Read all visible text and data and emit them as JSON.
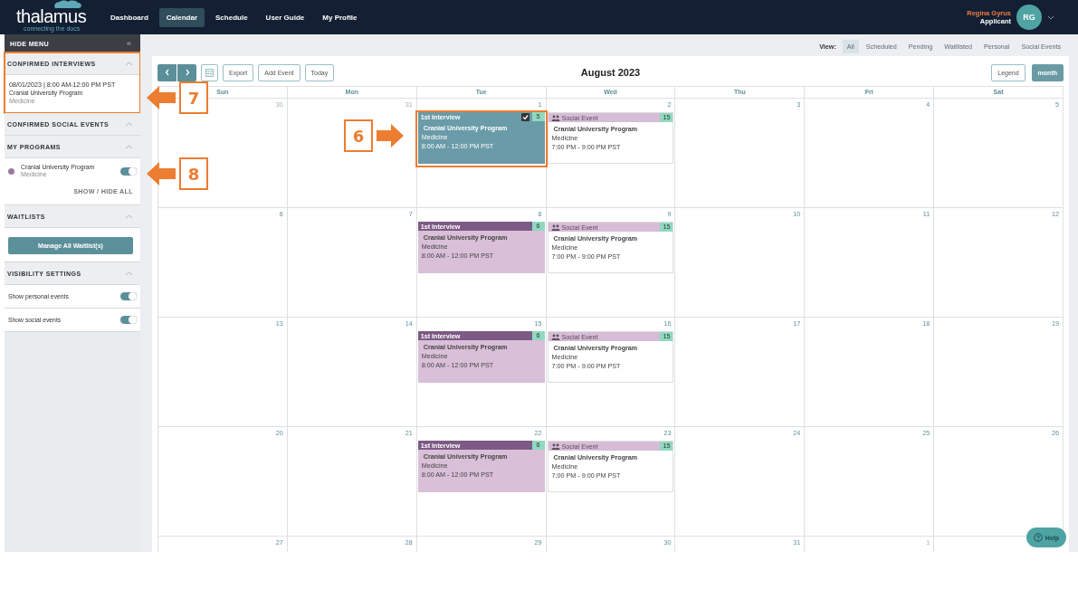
{
  "nav": {
    "logo": "thalamus",
    "tagline": "connecting the docs",
    "items": [
      {
        "label": "Dashboard",
        "selected": false
      },
      {
        "label": "Calendar",
        "selected": true
      },
      {
        "label": "Schedule",
        "selected": false
      },
      {
        "label": "User Guide",
        "selected": false
      },
      {
        "label": "My Profile",
        "selected": false
      }
    ],
    "user_name": "Regina Gyrus",
    "user_role": "Applicant",
    "avatar": "RG"
  },
  "sidebar": {
    "hide_menu": "HIDE MENU",
    "collapse_icon": "«",
    "confirmed_interviews": {
      "title": "CONFIRMED INTERVIEWS",
      "expanded": true,
      "highlighted": true,
      "items": [
        {
          "datetime": "08/01/2023 | 8:00 AM-12:00 PM PST",
          "program": "Cranial University Program",
          "specialty": "Medicine"
        }
      ]
    },
    "confirmed_social_events": {
      "title": "CONFIRMED SOCIAL EVENTS",
      "expanded": true
    },
    "my_programs": {
      "title": "MY PROGRAMS",
      "expanded": true,
      "programs": [
        {
          "name": "Cranial University Program",
          "specialty": "Medicine",
          "color": "#9e7a9c",
          "on": true
        }
      ],
      "show_hide_all": "SHOW / HIDE ALL"
    },
    "waitlists": {
      "title": "WAITLISTS",
      "expanded": true,
      "button": "Manage All Waitlist(s)"
    },
    "visibility_settings": {
      "title": "VISIBILITY SETTINGS",
      "expanded": true,
      "settings": [
        {
          "label": "Show personal events",
          "on": true
        },
        {
          "label": "Show social events",
          "on": true
        }
      ]
    }
  },
  "view_filter": {
    "label": "View:",
    "options": [
      {
        "label": "All",
        "selected": true
      },
      {
        "label": "Scheduled",
        "selected": false
      },
      {
        "label": "Pending",
        "selected": false
      },
      {
        "label": "Waitlisted",
        "selected": false
      },
      {
        "label": "Personal",
        "selected": false
      },
      {
        "label": "Social Events",
        "selected": false
      }
    ]
  },
  "calendar": {
    "buttons": [
      "Export",
      "Add Event",
      "Today"
    ],
    "title": "August 2023",
    "legend": "Legend",
    "view_button": {
      "label": "month",
      "selected": true
    },
    "weekdays": [
      "Sun",
      "Mon",
      "Tue",
      "Wed",
      "Thu",
      "Fri",
      "Sat"
    ],
    "weeks": [
      [
        {
          "day": "30",
          "outside": true
        },
        {
          "day": "31",
          "outside": true
        },
        {
          "day": "1",
          "outside": false,
          "events": [
            {
              "kind": "interview",
              "label": "1st Interview",
              "count": "5",
              "checked": true,
              "selected": true,
              "highlighted": true,
              "title": "Cranial University Program",
              "specialty": "Medicine",
              "time": "8:00 AM - 12:00 PM PST"
            }
          ]
        },
        {
          "day": "2",
          "outside": false,
          "events": [
            {
              "kind": "social",
              "label": "Social Event",
              "count": "15",
              "checked": false,
              "selected": false,
              "highlighted": false,
              "title": "Cranial University Program",
              "specialty": "Medicine",
              "time": "7:00 PM - 9:00 PM PST"
            }
          ]
        },
        {
          "day": "3",
          "outside": false
        },
        {
          "day": "4",
          "outside": false
        },
        {
          "day": "5",
          "outside": false
        }
      ],
      [
        {
          "day": "6",
          "outside": false
        },
        {
          "day": "7",
          "outside": false
        },
        {
          "day": "8",
          "outside": false,
          "events": [
            {
              "kind": "interview",
              "label": "1st Interview",
              "count": "6",
              "checked": false,
              "selected": false,
              "highlighted": false,
              "title": "Cranial University Program",
              "specialty": "Medicine",
              "time": "8:00 AM - 12:00 PM PST"
            }
          ]
        },
        {
          "day": "9",
          "outside": false,
          "events": [
            {
              "kind": "social",
              "label": "Social Event",
              "count": "15",
              "checked": false,
              "selected": false,
              "highlighted": false,
              "title": "Cranial University Program",
              "specialty": "Medicine",
              "time": "7:00 PM - 9:00 PM PST"
            }
          ]
        },
        {
          "day": "10",
          "outside": false
        },
        {
          "day": "11",
          "outside": false
        },
        {
          "day": "12",
          "outside": false
        }
      ],
      [
        {
          "day": "13",
          "outside": false
        },
        {
          "day": "14",
          "outside": false
        },
        {
          "day": "15",
          "outside": false,
          "events": [
            {
              "kind": "interview",
              "label": "1st Interview",
              "count": "6",
              "checked": false,
              "selected": false,
              "highlighted": false,
              "title": "Cranial University Program",
              "specialty": "Medicine",
              "time": "8:00 AM - 12:00 PM PST"
            }
          ]
        },
        {
          "day": "16",
          "outside": false,
          "events": [
            {
              "kind": "social",
              "label": "Social Event",
              "count": "15",
              "checked": false,
              "selected": false,
              "highlighted": false,
              "title": "Cranial University Program",
              "specialty": "Medicine",
              "time": "7:00 PM - 9:00 PM PST"
            }
          ]
        },
        {
          "day": "17",
          "outside": false
        },
        {
          "day": "18",
          "outside": false
        },
        {
          "day": "19",
          "outside": false
        }
      ],
      [
        {
          "day": "20",
          "outside": false
        },
        {
          "day": "21",
          "outside": false
        },
        {
          "day": "22",
          "outside": false,
          "events": [
            {
              "kind": "interview",
              "label": "1st Interview",
              "count": "6",
              "checked": false,
              "selected": false,
              "highlighted": false,
              "title": "Cranial University Program",
              "specialty": "Medicine",
              "time": "8:00 AM - 12:00 PM PST"
            }
          ]
        },
        {
          "day": "23",
          "outside": false,
          "events": [
            {
              "kind": "social",
              "label": "Social Event",
              "count": "15",
              "checked": false,
              "selected": false,
              "highlighted": false,
              "title": "Cranial University Program",
              "specialty": "Medicine",
              "time": "7:00 PM - 9:00 PM PST"
            }
          ]
        },
        {
          "day": "24",
          "outside": false
        },
        {
          "day": "25",
          "outside": false
        },
        {
          "day": "26",
          "outside": false
        }
      ],
      [
        {
          "day": "27",
          "outside": false
        },
        {
          "day": "28",
          "outside": false
        },
        {
          "day": "29",
          "outside": false
        },
        {
          "day": "30",
          "outside": false
        },
        {
          "day": "31",
          "outside": false
        },
        {
          "day": "1",
          "outside": true
        }
      ]
    ]
  },
  "help_button": "Help",
  "callouts": [
    {
      "number": "7",
      "kind": "arrow_left"
    },
    {
      "number": "8",
      "kind": "arrow_left"
    },
    {
      "number": "6",
      "kind": "arrow_right"
    }
  ]
}
